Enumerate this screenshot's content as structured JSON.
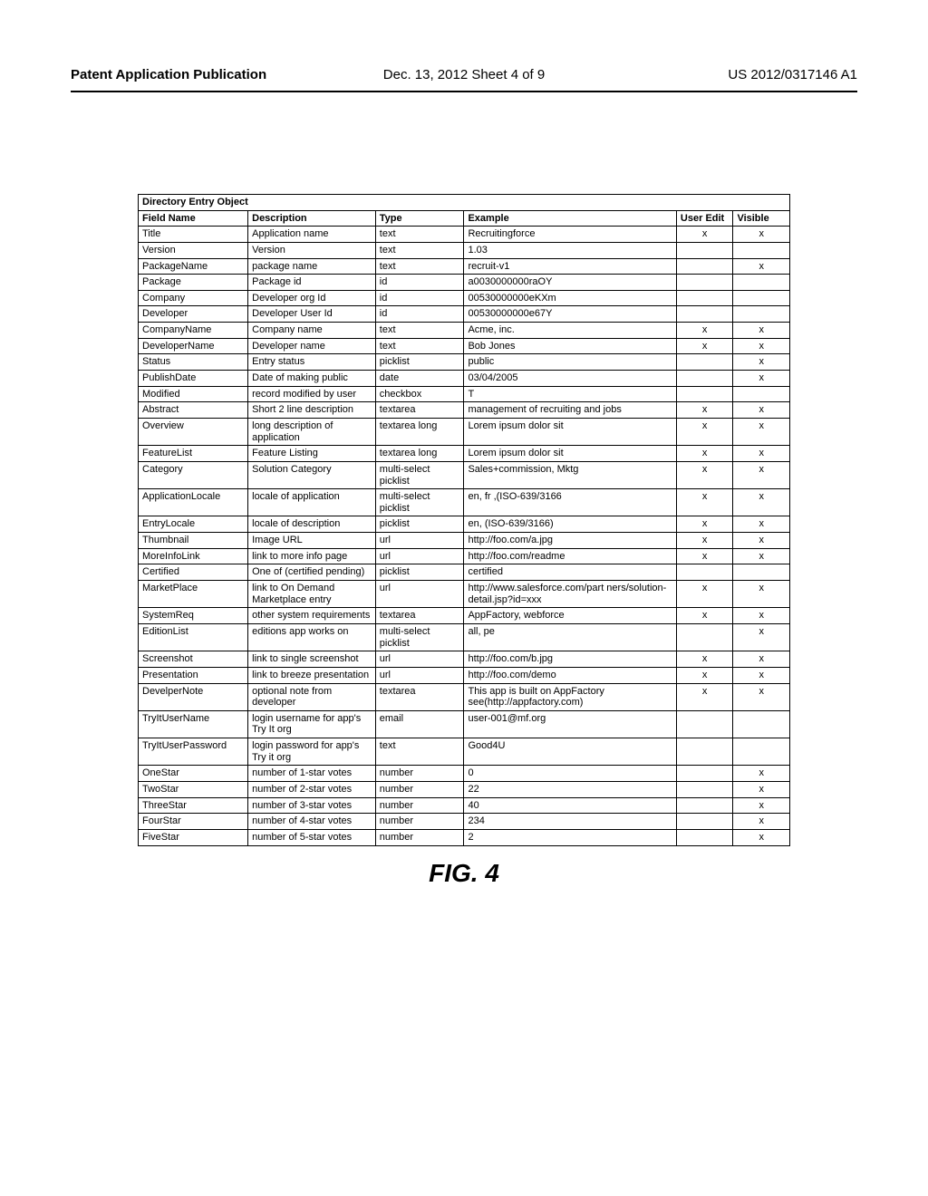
{
  "header": {
    "left": "Patent Application Publication",
    "center": "Dec. 13, 2012  Sheet 4 of 9",
    "right": "US 2012/0317146 A1"
  },
  "table": {
    "section_title": "Directory Entry Object",
    "columns": [
      "Field Name",
      "Description",
      "Type",
      "Example",
      "User Edit",
      "Visible"
    ],
    "rows": [
      {
        "field": "Title",
        "desc": "Application name",
        "type": "text",
        "example": "Recruitingforce",
        "edit": "x",
        "visible": "x"
      },
      {
        "field": "Version",
        "desc": "Version",
        "type": "text",
        "example": "1.03",
        "edit": "",
        "visible": ""
      },
      {
        "field": "PackageName",
        "desc": "package name",
        "type": "text",
        "example": "recruit-v1",
        "edit": "",
        "visible": "x"
      },
      {
        "field": "Package",
        "desc": "Package id",
        "type": "id",
        "example": "a0030000000raOY",
        "edit": "",
        "visible": ""
      },
      {
        "field": "Company",
        "desc": "Developer org Id",
        "type": "id",
        "example": "00530000000eKXm",
        "edit": "",
        "visible": ""
      },
      {
        "field": "Developer",
        "desc": "Developer User Id",
        "type": "id",
        "example": "00530000000e67Y",
        "edit": "",
        "visible": ""
      },
      {
        "field": "CompanyName",
        "desc": "Company name",
        "type": "text",
        "example": "Acme, inc.",
        "edit": "x",
        "visible": "x"
      },
      {
        "field": "DeveloperName",
        "desc": "Developer name",
        "type": "text",
        "example": "Bob Jones",
        "edit": "x",
        "visible": "x"
      },
      {
        "field": "Status",
        "desc": "Entry status",
        "type": "picklist",
        "example": "public",
        "edit": "",
        "visible": "x"
      },
      {
        "field": "PublishDate",
        "desc": "Date of making public",
        "type": "date",
        "example": "03/04/2005",
        "edit": "",
        "visible": "x"
      },
      {
        "field": "Modified",
        "desc": "record modified by user",
        "type": "checkbox",
        "example": "T",
        "edit": "",
        "visible": ""
      },
      {
        "field": "Abstract",
        "desc": "Short 2 line description",
        "type": "textarea",
        "example": "management of recruiting and jobs",
        "edit": "x",
        "visible": "x"
      },
      {
        "field": "Overview",
        "desc": "long description of application",
        "type": "textarea long",
        "example": "Lorem ipsum dolor sit",
        "edit": "x",
        "visible": "x"
      },
      {
        "field": "FeatureList",
        "desc": "Feature Listing",
        "type": "textarea long",
        "example": "Lorem ipsum dolor sit",
        "edit": "x",
        "visible": "x"
      },
      {
        "field": "Category",
        "desc": "Solution Category",
        "type": "multi-select picklist",
        "example": "Sales+commission, Mktg",
        "edit": "x",
        "visible": "x"
      },
      {
        "field": "ApplicationLocale",
        "desc": "locale of application",
        "type": "multi-select picklist",
        "example": "en, fr ,(ISO-639/3166",
        "edit": "x",
        "visible": "x"
      },
      {
        "field": "EntryLocale",
        "desc": "locale of description",
        "type": "picklist",
        "example": "en, (ISO-639/3166)",
        "edit": "x",
        "visible": "x"
      },
      {
        "field": "Thumbnail",
        "desc": "Image URL",
        "type": "url",
        "example": "http://foo.com/a.jpg",
        "edit": "x",
        "visible": "x"
      },
      {
        "field": "MoreInfoLink",
        "desc": "link to more info page",
        "type": "url",
        "example": "http://foo.com/readme",
        "edit": "x",
        "visible": "x"
      },
      {
        "field": "Certified",
        "desc": "One of (certified pending)",
        "type": "picklist",
        "example": "certified",
        "edit": "",
        "visible": ""
      },
      {
        "field": "MarketPlace",
        "desc": "link to On Demand Marketplace entry",
        "type": "url",
        "example": "http://www.salesforce.com/part ners/solution-detail.jsp?id=xxx",
        "edit": "x",
        "visible": "x"
      },
      {
        "field": "SystemReq",
        "desc": "other system requirements",
        "type": "textarea",
        "example": "AppFactory, webforce",
        "edit": "x",
        "visible": "x"
      },
      {
        "field": "EditionList",
        "desc": "editions app works on",
        "type": "multi-select picklist",
        "example": "all, pe",
        "edit": "",
        "visible": "x"
      },
      {
        "field": "Screenshot",
        "desc": "link to single screenshot",
        "type": "url",
        "example": "http://foo.com/b.jpg",
        "edit": "x",
        "visible": "x"
      },
      {
        "field": "Presentation",
        "desc": "link to breeze presentation",
        "type": "url",
        "example": "http://foo.com/demo",
        "edit": "x",
        "visible": "x"
      },
      {
        "field": "DevelperNote",
        "desc": "optional note from developer",
        "type": "textarea",
        "example": "This app is built on AppFactory see(http://appfactory.com)",
        "edit": "x",
        "visible": "x"
      },
      {
        "field": "TryItUserName",
        "desc": "login username for app's Try It org",
        "type": "email",
        "example": "user-001@mf.org",
        "edit": "",
        "visible": ""
      },
      {
        "field": "TryItUserPassword",
        "desc": "login password for app's Try it org",
        "type": "text",
        "example": "Good4U",
        "edit": "",
        "visible": ""
      },
      {
        "field": "OneStar",
        "desc": "number of 1-star votes",
        "type": "number",
        "example": "0",
        "edit": "",
        "visible": "x"
      },
      {
        "field": "TwoStar",
        "desc": "number of 2-star votes",
        "type": "number",
        "example": "22",
        "edit": "",
        "visible": "x"
      },
      {
        "field": "ThreeStar",
        "desc": "number of 3-star votes",
        "type": "number",
        "example": "40",
        "edit": "",
        "visible": "x"
      },
      {
        "field": "FourStar",
        "desc": "number of 4-star votes",
        "type": "number",
        "example": "234",
        "edit": "",
        "visible": "x"
      },
      {
        "field": "FiveStar",
        "desc": "number of 5-star votes",
        "type": "number",
        "example": "2",
        "edit": "",
        "visible": "x"
      }
    ]
  },
  "figure_caption": "FIG. 4"
}
